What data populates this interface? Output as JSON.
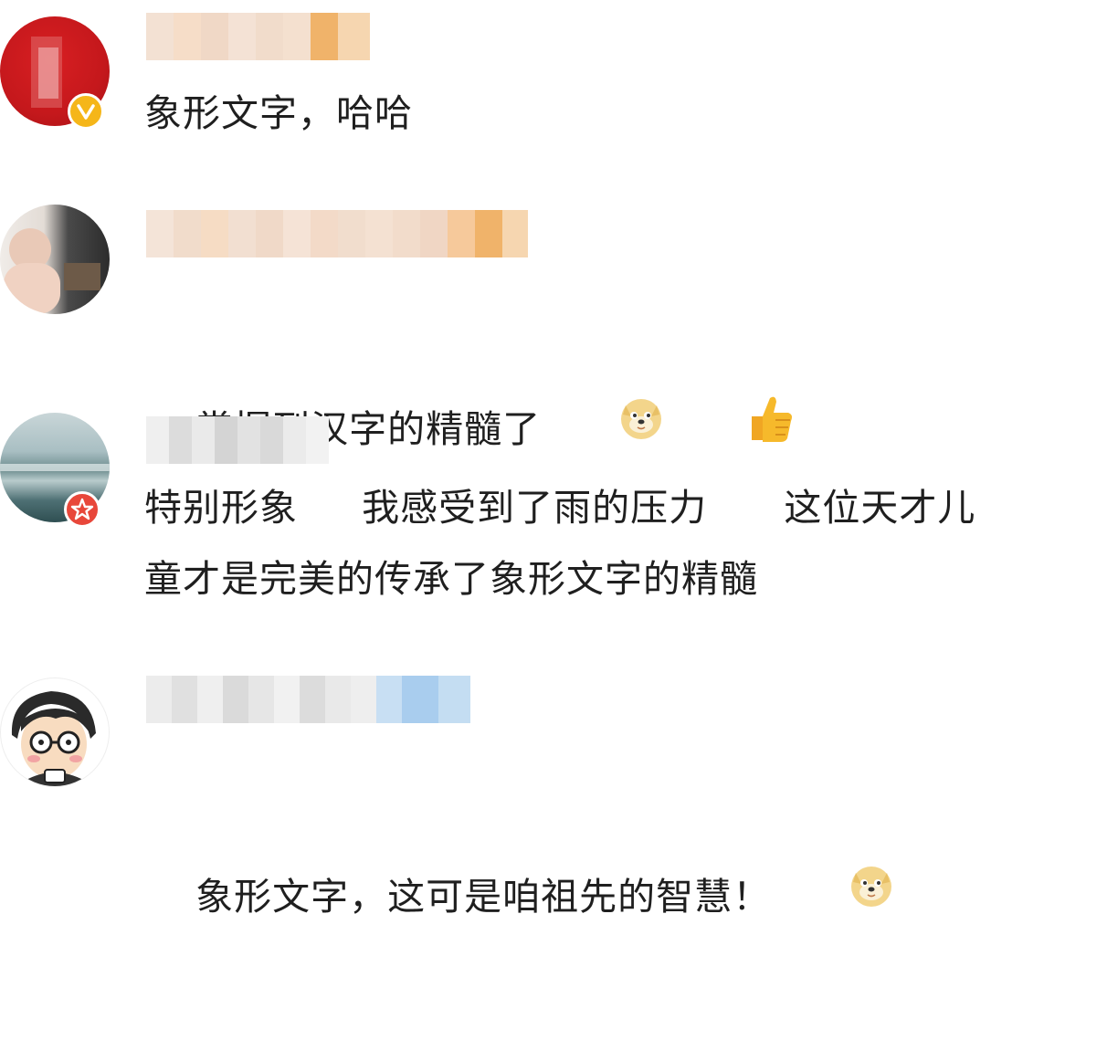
{
  "comments": [
    {
      "text": "象形文字，哈哈",
      "badge": "verified-v-icon",
      "avatar": "red-avatar"
    },
    {
      "text": "掌握到汉字的精髓了",
      "emojis": [
        "doge-emoji-icon",
        "thumbs-up-icon"
      ],
      "avatar": "child-photo-avatar"
    },
    {
      "line1": "特别形象     我感受到了雨的压力      这位天才儿",
      "line2": "童才是完美的传承了象形文字的精髓",
      "badge": "star-badge-icon",
      "avatar": "sea-photo-avatar"
    },
    {
      "text": "象形文字，这可是咱祖先的智慧！",
      "emojis": [
        "doge-emoji-icon"
      ],
      "avatar": "cartoon-avatar"
    }
  ],
  "colors": {
    "text": "#1f1f1f",
    "verified_badge": "#f5b619",
    "star_badge": "#e8473a"
  }
}
